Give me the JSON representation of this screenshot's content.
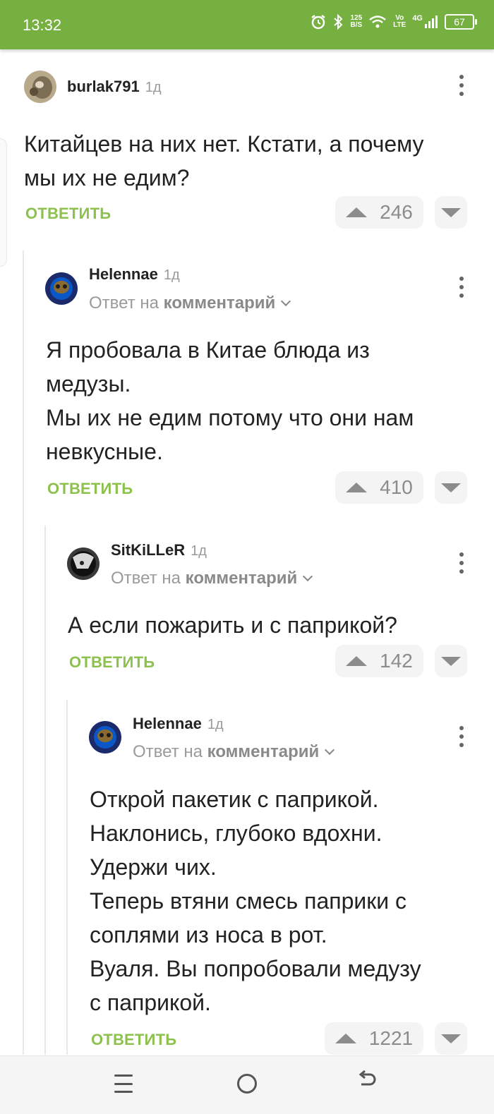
{
  "status": {
    "time": "13:32",
    "net_speed_value": "125",
    "net_speed_unit": "B/S",
    "volte_top": "Vo",
    "volte_bottom": "LTE",
    "network": "4G",
    "battery": "67"
  },
  "reply_label": "ОТВЕТИТЬ",
  "reply_to_prefix": "Ответ на",
  "reply_to_link": "комментарий",
  "comments": [
    {
      "author": "burlak791",
      "age": "1д",
      "text": "Китайцев на них нет. Кстати, а почему\nмы их не едим?",
      "rating": "246"
    },
    {
      "author": "Helennae",
      "age": "1д",
      "text": "Я пробовала в Китае блюда из\nмедузы.\nМы их не едим потому что они нам\nневкусные.",
      "rating": "410"
    },
    {
      "author": "SitKiLLeR",
      "age": "1д",
      "text": "А если пожарить и с паприкой?",
      "rating": "142"
    },
    {
      "author": "Helennae",
      "age": "1д",
      "text": "Открой пакетик с паприкой.\nНаклонись, глубоко вдохни.\nУдержи чих.\nТеперь втяни смесь паприки с\nсоплями из носа в рот.\nВуаля. Вы попробовали медузу\nс паприкой.",
      "rating": "1221"
    }
  ],
  "colors": {
    "brand_green": "#76b041",
    "reply_green": "#8dc14e"
  }
}
